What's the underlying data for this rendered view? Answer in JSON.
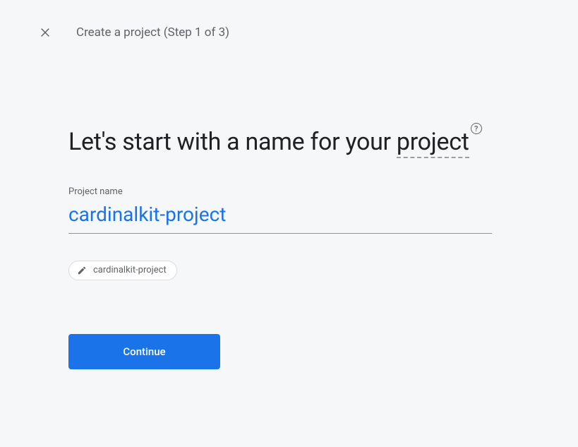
{
  "header": {
    "title": "Create a project (Step 1 of 3)"
  },
  "main": {
    "heading_prefix": "Let's start with a name for your ",
    "heading_project_word": "project",
    "project_field": {
      "label": "Project name",
      "value": "cardinalkit-project"
    },
    "id_chip": {
      "text": "cardinalkit-project"
    },
    "continue_label": "Continue"
  }
}
